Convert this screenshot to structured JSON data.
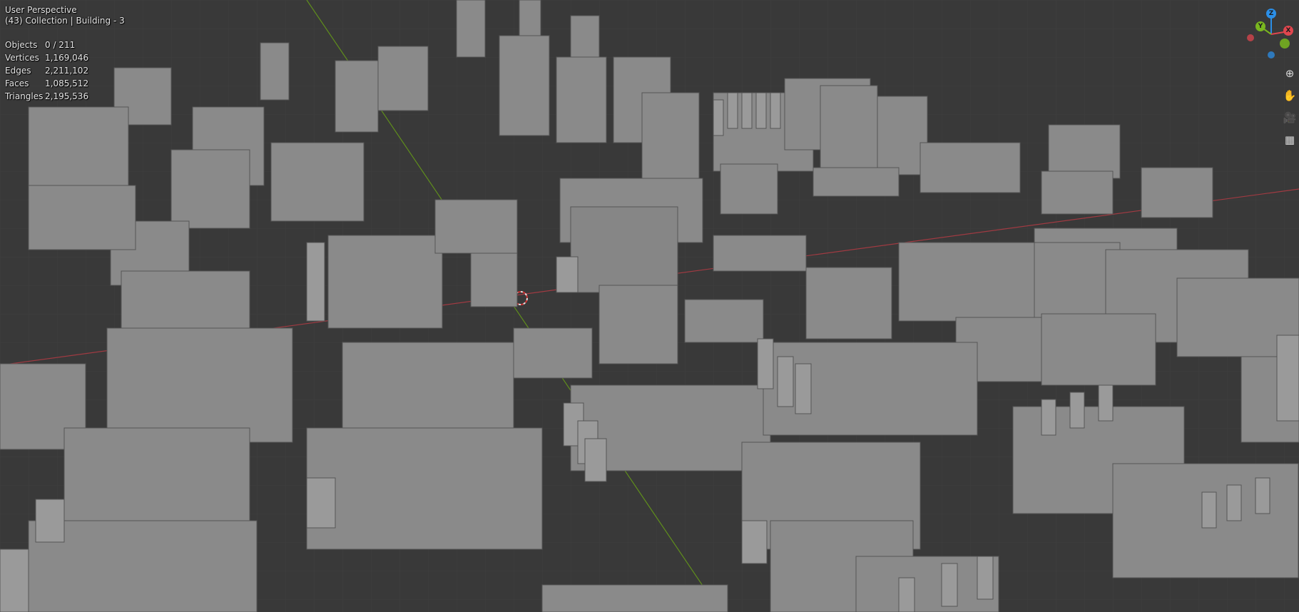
{
  "viewport": {
    "perspective": "User Perspective",
    "collection_line": "(43) Collection | Building - 3"
  },
  "stats": [
    {
      "label": "Objects",
      "value": "0 / 211"
    },
    {
      "label": "Vertices",
      "value": "1,169,046"
    },
    {
      "label": "Edges",
      "value": "2,211,102"
    },
    {
      "label": "Faces",
      "value": "1,085,512"
    },
    {
      "label": "Triangles",
      "value": "2,195,536"
    }
  ],
  "gizmo": {
    "z_label": "Z",
    "y_label": "Y",
    "x_label": "X",
    "colors": {
      "x": "#e0464e",
      "y": "#79b61f",
      "z": "#2b8fe8"
    }
  },
  "nav_tools": [
    {
      "name": "zoom",
      "icon": "zoom-icon",
      "glyph": "⊕"
    },
    {
      "name": "pan",
      "icon": "hand-pan-icon",
      "glyph": "✋"
    },
    {
      "name": "camera",
      "icon": "camera-icon",
      "glyph": "🎥"
    },
    {
      "name": "ortho",
      "icon": "grid-ortho-icon",
      "glyph": "▦"
    }
  ],
  "colors": {
    "background": "#3a3a3a",
    "grid": "#444444",
    "x_axis_line": "#b8414a",
    "y_axis_line": "#6c9a1f",
    "mesh": "#8e8e8e"
  }
}
